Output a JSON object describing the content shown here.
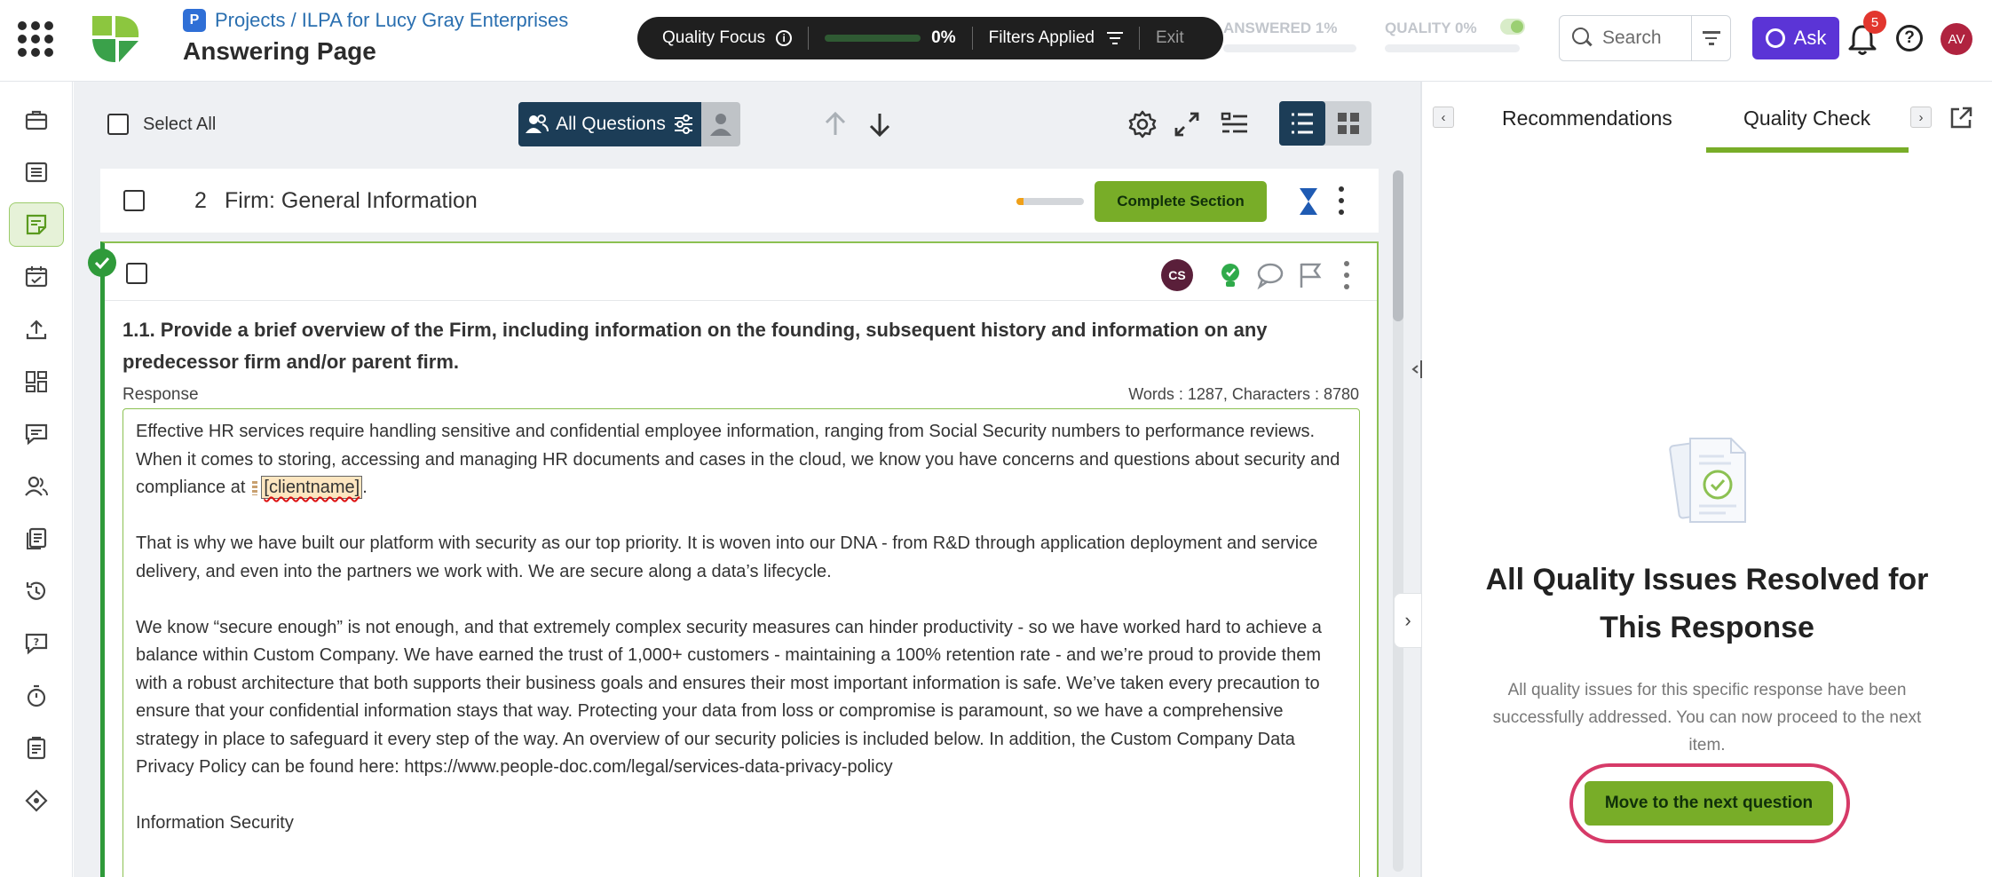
{
  "header": {
    "breadcrumb": "Projects / ILPA for Lucy Gray Enterprises",
    "project_badge": "P",
    "page_title": "Answering Page",
    "quality_focus": {
      "label": "Quality Focus",
      "progress": "0%",
      "progress_fraction": 0,
      "filters_label": "Filters Applied",
      "exit_label": "Exit"
    },
    "answered_label": "ANSWERED 1%",
    "answered_fraction": 0.01,
    "quality_label": "QUALITY 0%",
    "quality_fraction": 0,
    "search_placeholder": "Search",
    "ask_label": "Ask",
    "notification_count": "5",
    "help_glyph": "?",
    "avatar_initials": "AV"
  },
  "rail": {
    "icons": [
      "briefcase-icon",
      "list-icon",
      "answer-note-icon",
      "calendar-check-icon",
      "upload-icon",
      "dashboard-icon",
      "chat-icon",
      "users-icon",
      "documents-icon",
      "history-icon",
      "question-chat-icon",
      "timer-icon",
      "clipboard-icon",
      "integrations-icon"
    ],
    "active_index": 2
  },
  "toolbar": {
    "select_all": "Select All",
    "all_questions": "All Questions"
  },
  "section": {
    "number": "2",
    "title": "Firm: General Information",
    "progress_fraction": 0.1,
    "complete_label": "Complete Section"
  },
  "question": {
    "assignee_initials": "CS",
    "text": "1.1. Provide a brief overview of the Firm, including information on the founding, subsequent history and information on any predecessor firm and/or parent firm.",
    "response_label": "Response",
    "counts": "Words : 1287, Characters : 8780",
    "response": {
      "p1": "Effective HR services require handling sensitive and confidential employee information, ranging from Social Security numbers to performance reviews. When it comes to storing, accessing and managing HR documents and cases in the cloud, we know you have concerns and questions about security and compliance at",
      "p1_merge": "[clientname]",
      "p1_end": ".",
      "p2": "That is why we have built our platform with security as our top priority. It is woven into our DNA - from R&D through application deployment and service delivery, and even into the partners we work with. We are secure along a data’s lifecycle.",
      "p3": "We know “secure enough” is not enough, and that extremely complex security measures can hinder productivity - so we have worked hard to achieve a balance within Custom Company. We have earned the trust of 1,000+ customers - maintaining a 100% retention rate - and we’re proud to provide them with a robust architecture that both supports their business goals and ensures their most important information is safe. We’ve taken every precaution to ensure that your confidential information stays that way. Protecting your data from loss or compromise is paramount, so we have a comprehensive strategy in place to safeguard it every step of the way. An overview of our security policies is included below. In addition, the Custom Company Data Privacy Policy can be found here: https://www.people-doc.com/legal/services-data-privacy-policy",
      "p4": "Information Security"
    }
  },
  "right_panel": {
    "tab_recommendations": "Recommendations",
    "tab_quality": "Quality Check",
    "done_title": "All Quality Issues Resolved for This Response",
    "done_desc": "All quality issues for this specific response have been successfully addressed. You can now proceed to the next item.",
    "next_label": "Move to the next question"
  },
  "colors": {
    "brand_green": "#78ad28",
    "dark_navy": "#1c3d57",
    "ask_purple": "#5b34d6",
    "highlight_ring": "#d63a68"
  }
}
